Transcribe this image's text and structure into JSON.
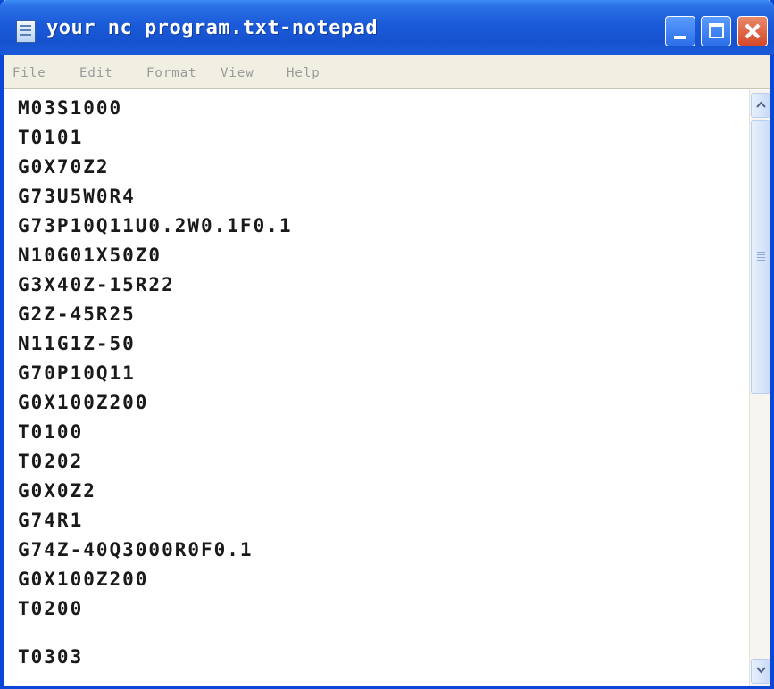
{
  "window": {
    "title": "your nc program.txt-notepad",
    "icon": "notepad-icon",
    "controls": {
      "minimize": "minimize-icon",
      "maximize": "maximize-icon",
      "close": "close-icon"
    }
  },
  "menu": {
    "items": [
      "File",
      "Edit",
      "Format",
      "View",
      "Help"
    ]
  },
  "editor": {
    "lines": [
      "M03S1000",
      "T0101",
      "G0X70Z2",
      "G73U5W0R4",
      "G73P10Q11U0.2W0.1F0.1",
      "N10G01X50Z0",
      "G3X40Z-15R22",
      "G2Z-45R25",
      "N11G1Z-50",
      "G70P10Q11",
      "G0X100Z200",
      "T0100",
      "T0202",
      "G0X0Z2",
      "G74R1",
      "G74Z-40Q3000R0F0.1",
      "G0X100Z200",
      "T0200",
      "",
      "T0303"
    ]
  },
  "scrollbar": {
    "up_icon": "scroll-up-arrow-icon",
    "down_icon": "scroll-down-arrow-icon"
  },
  "colors": {
    "titlebar": "#1652d0",
    "menubar_bg": "#f1efe2",
    "menu_text": "#9a9a9a",
    "editor_text": "#1a1a1a"
  }
}
